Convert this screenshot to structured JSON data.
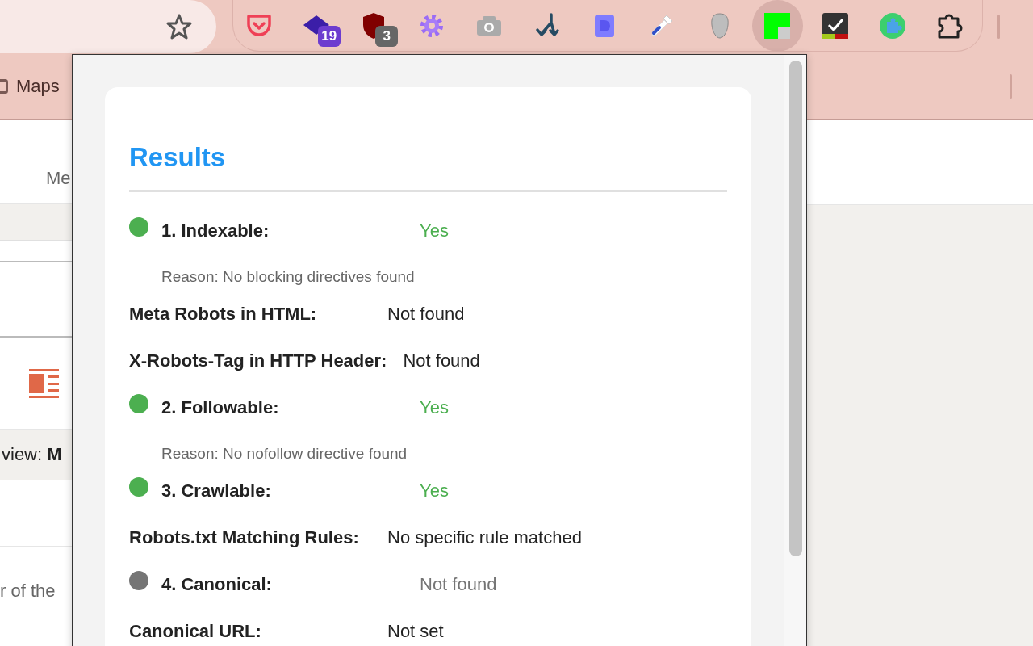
{
  "toolbar": {
    "extensions": [
      {
        "kind": "pocket",
        "selected": false
      },
      {
        "kind": "cap",
        "badge": "19",
        "color": "#6c3ccf",
        "selected": false
      },
      {
        "kind": "shield",
        "badge": "3",
        "color": "#666666",
        "selected": false
      },
      {
        "kind": "gear",
        "selected": false
      },
      {
        "kind": "camera",
        "selected": false
      },
      {
        "kind": "merge",
        "selected": false
      },
      {
        "kind": "dblock",
        "selected": false
      },
      {
        "kind": "dropper",
        "selected": false
      },
      {
        "kind": "mask",
        "selected": false
      },
      {
        "kind": "squares",
        "selected": true
      },
      {
        "kind": "check",
        "selected": false
      },
      {
        "kind": "puzzle-green",
        "selected": false
      },
      {
        "kind": "puzzle",
        "selected": false
      }
    ]
  },
  "bookmarks_bar": {
    "items": [
      "Maps"
    ]
  },
  "page": {
    "heading_fragment": "Me",
    "band_fragment": "view: **M**",
    "text_fragment": "r of the"
  },
  "popup": {
    "title": "Results",
    "items": [
      {
        "kind": "check",
        "label": "1. Indexable:",
        "value": "Yes",
        "color": "#4caf50",
        "reason": "Reason: No blocking directives found"
      },
      {
        "kind": "detail",
        "label": "Meta Robots in HTML:",
        "value": "Not found"
      },
      {
        "kind": "detail",
        "label": "X-Robots-Tag in HTTP Header:",
        "value": "Not found"
      },
      {
        "kind": "check",
        "label": "2. Followable:",
        "value": "Yes",
        "color": "#4caf50",
        "reason": "Reason: No nofollow directive found"
      },
      {
        "kind": "check",
        "label": "3. Crawlable:",
        "value": "Yes",
        "color": "#4caf50"
      },
      {
        "kind": "detail",
        "label": "Robots.txt Matching Rules:",
        "value": "No specific rule matched"
      },
      {
        "kind": "check",
        "label": "4. Canonical:",
        "value": "Not found",
        "color": "#757575"
      },
      {
        "kind": "detail",
        "label": "Canonical URL:",
        "value": "Not set"
      }
    ]
  }
}
